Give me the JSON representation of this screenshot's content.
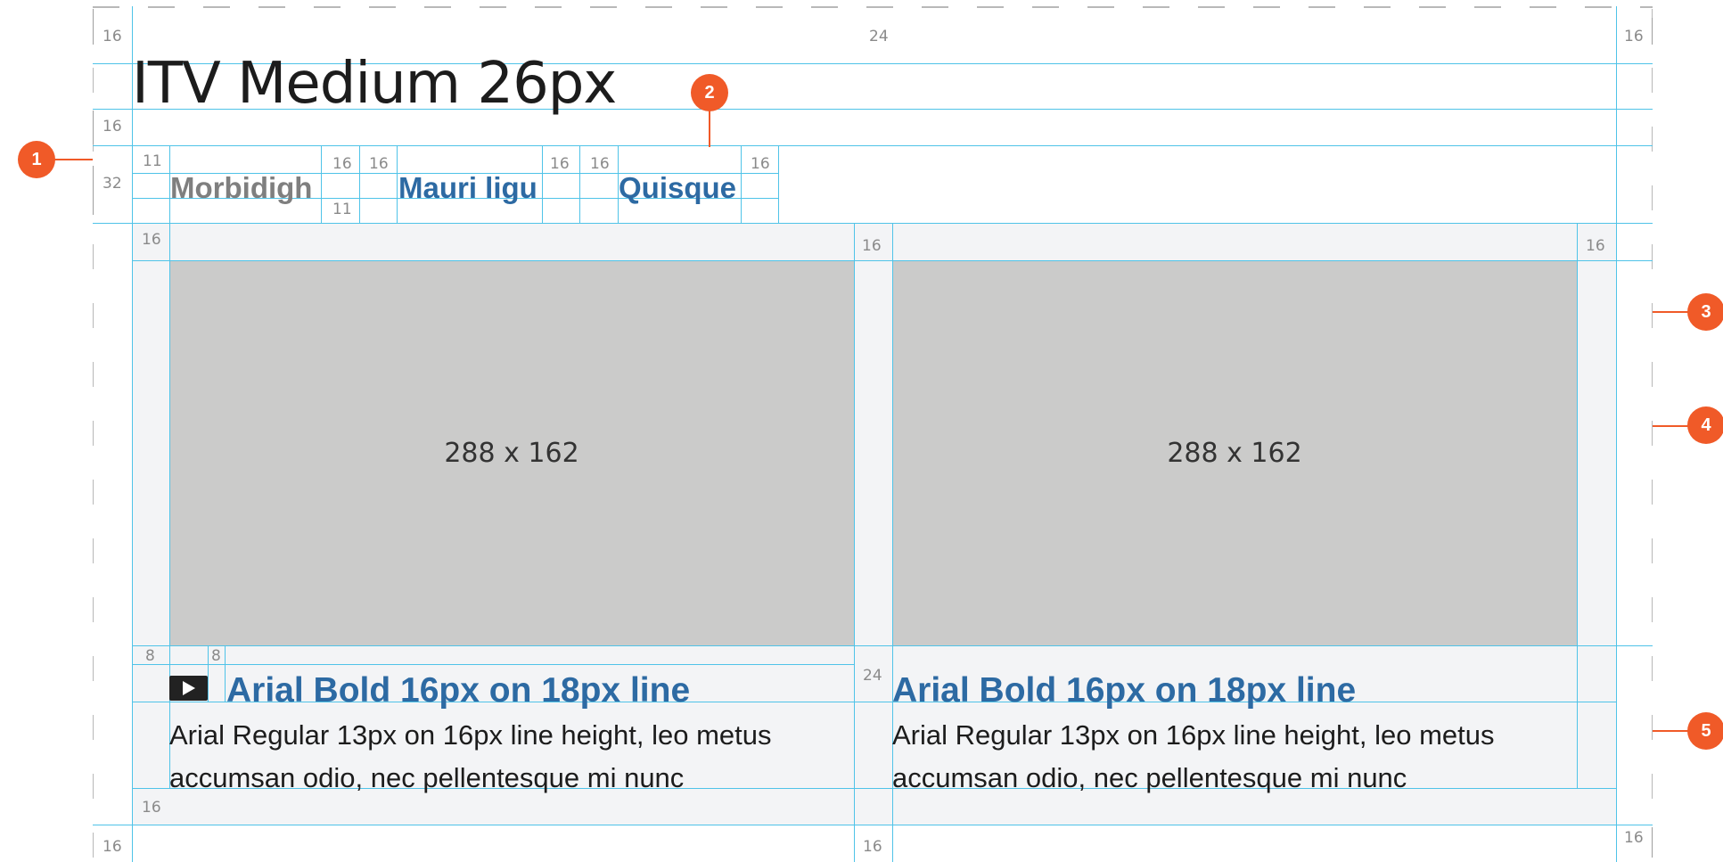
{
  "title": "ITV Medium 26px",
  "tabs": [
    {
      "label": "Morbidigh",
      "color": "#7f7f7f"
    },
    {
      "label": "Mauri ligu",
      "color": "#2d6aa3"
    },
    {
      "label": "Quisque",
      "color": "#2d6aa3"
    }
  ],
  "cards": [
    {
      "thumb_label": "288 x 162",
      "title": "Arial Bold 16px on 18px line",
      "desc_lines": [
        "Arial Regular 13px on 16px line height, leo metus",
        "accumsan odio, nec pellentesque mi nunc"
      ],
      "has_play_icon": true
    },
    {
      "thumb_label": "288 x 162",
      "title": "Arial Bold 16px on 18px line",
      "desc_lines": [
        "Arial Regular 13px on 16px line height, leo metus",
        "accumsan odio, nec pellentesque mi nunc"
      ],
      "has_play_icon": false
    }
  ],
  "measurements": {
    "top_left": "16",
    "top_center": "24",
    "top_right": "16",
    "title_gap": "16",
    "tab_row": "32",
    "tab_pad_top": "11",
    "tab_pad_bottom": "11",
    "tab_gaps": [
      "16",
      "16",
      "16",
      "16",
      "16"
    ],
    "panel_left": "16",
    "panel_mid": "16",
    "panel_right": "16",
    "icon_gap_a": "8",
    "icon_gap_b": "8",
    "card_gap": "24",
    "panel_bottom": "16",
    "bottom_left": "16",
    "bottom_mid": "16",
    "bottom_right": "16"
  },
  "callouts": [
    "1",
    "2",
    "3",
    "4",
    "5"
  ],
  "colors": {
    "accent": "#f05a28",
    "guide": "#4fc3e8",
    "link": "#2d6aa3",
    "placeholder": "#cbcbca"
  }
}
